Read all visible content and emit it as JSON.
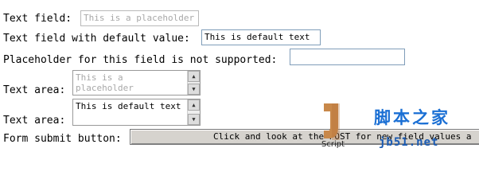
{
  "rows": [
    {
      "label": "Text field:",
      "placeholder": "This is a placeholder"
    },
    {
      "label": "Text field with default value:",
      "value": "This is default text"
    },
    {
      "label": "Placeholder for this field is not supported:",
      "value": ""
    },
    {
      "label": "Text area:",
      "placeholder": "This is a placeholder"
    },
    {
      "label": "Text area:",
      "value": "This is default text"
    },
    {
      "label": "Form submit button:"
    }
  ],
  "submit": {
    "label": "Click and look at the POST for new field values a"
  },
  "watermark": {
    "logo_text": "Script",
    "brand_cn": "脚本之家",
    "site": "jb51.net"
  }
}
